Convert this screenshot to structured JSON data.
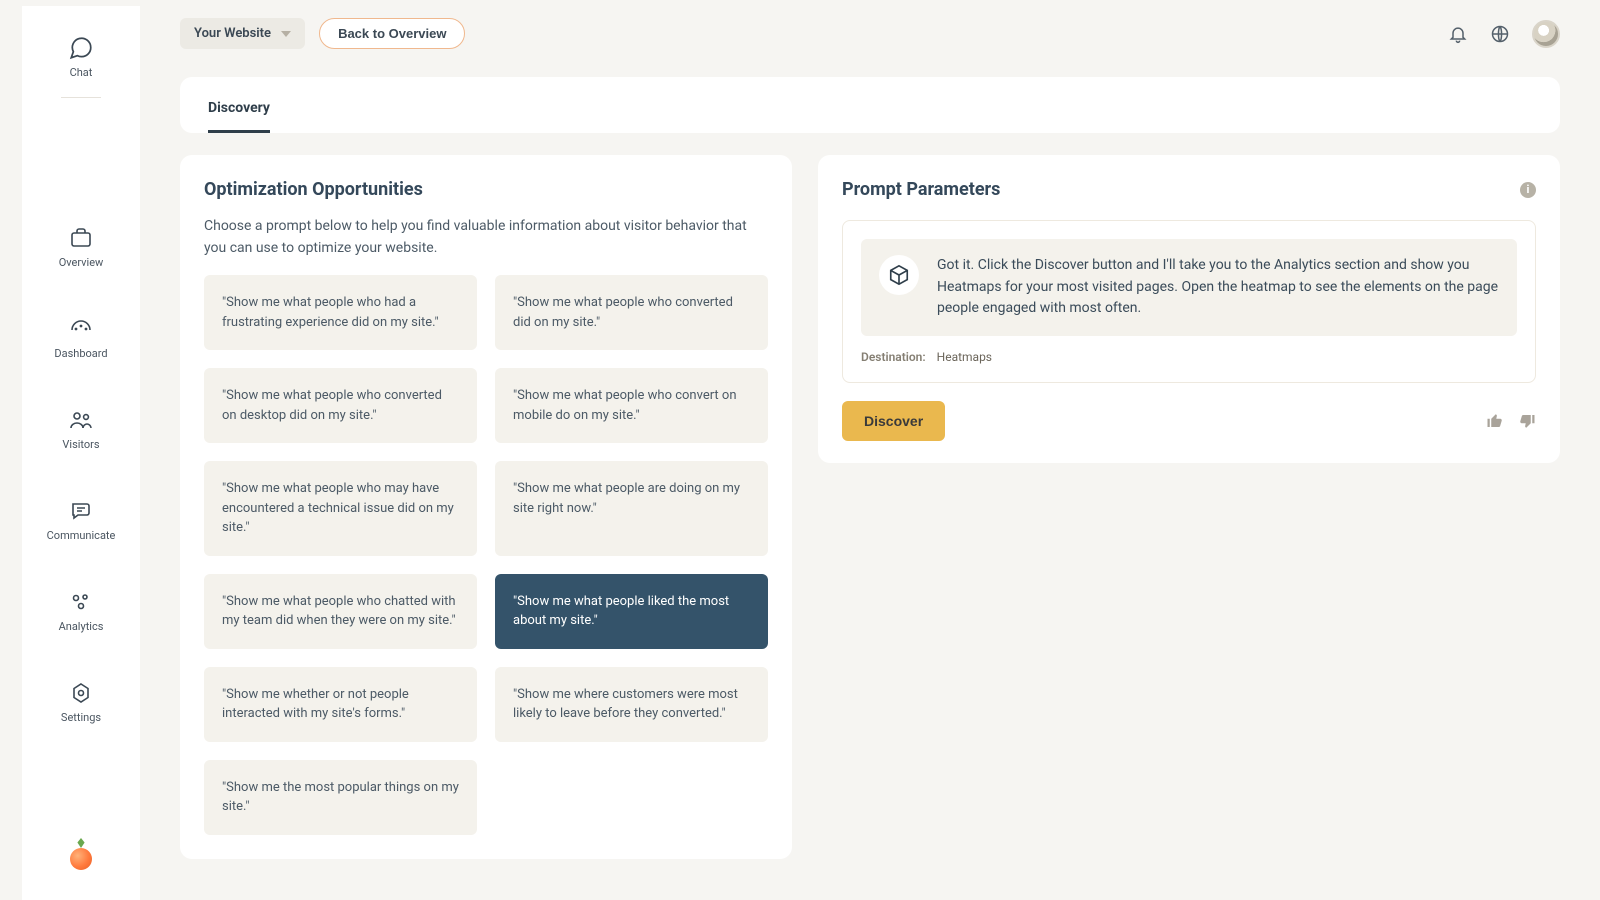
{
  "sidebar": {
    "chat": "Chat",
    "items": [
      {
        "label": "Overview"
      },
      {
        "label": "Dashboard"
      },
      {
        "label": "Visitors"
      },
      {
        "label": "Communicate"
      },
      {
        "label": "Analytics"
      },
      {
        "label": "Settings"
      }
    ]
  },
  "topbar": {
    "site_label": "Your Website",
    "back_label": "Back to Overview"
  },
  "tabs": {
    "discovery": "Discovery"
  },
  "opportunities": {
    "title": "Optimization Opportunities",
    "lede": "Choose a prompt below to help you find valuable information about visitor behavior that you can use to optimize your website.",
    "prompts": [
      "\"Show me what people who had a frustrating experience did on my site.\"",
      "\"Show me what people who converted did on my site.\"",
      "\"Show me what people who converted on desktop did on my site.\"",
      "\"Show me what people who convert on mobile do on my site.\"",
      "\"Show me what people who may have encountered a technical issue did on my site.\"",
      "\"Show me what people are doing on my site right now.\"",
      "\"Show me what people who chatted with my team did when they were on my site.\"",
      "\"Show me what people liked the most about my site.\"",
      "\"Show me whether or not people interacted with my site's forms.\"",
      "\"Show me where customers were most likely to leave before they converted.\"",
      "\"Show me the most popular things on my site.\""
    ],
    "selected_index": 7
  },
  "parameters": {
    "title": "Prompt Parameters",
    "info_glyph": "i",
    "assistant_text": "Got it. Click the Discover button and I'll take you to the Analytics section and show you Heatmaps for your most visited pages. Open the heatmap to see the elements on the page people engaged with most often.",
    "destination_label": "Destination:",
    "destination_value": "Heatmaps",
    "discover_label": "Discover"
  }
}
